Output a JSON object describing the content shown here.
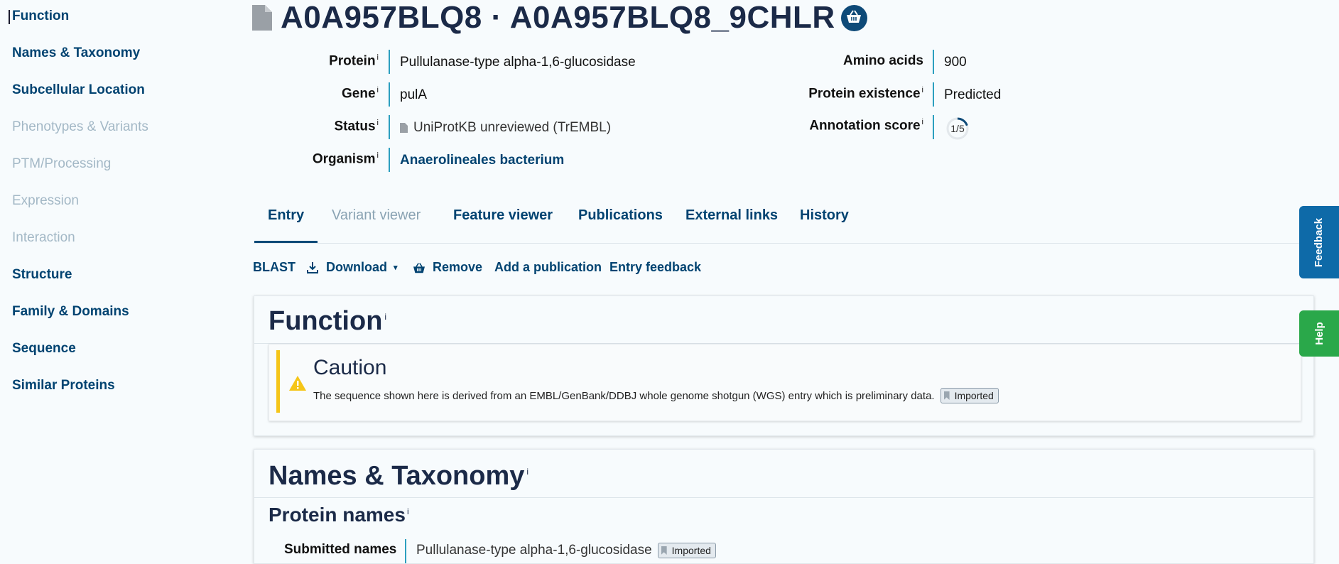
{
  "sidebar": {
    "items": [
      {
        "label": "Function",
        "state": "active"
      },
      {
        "label": "Names & Taxonomy",
        "state": "enabled"
      },
      {
        "label": "Subcellular Location",
        "state": "enabled"
      },
      {
        "label": "Phenotypes & Variants",
        "state": "disabled"
      },
      {
        "label": "PTM/Processing",
        "state": "disabled"
      },
      {
        "label": "Expression",
        "state": "disabled"
      },
      {
        "label": "Interaction",
        "state": "disabled"
      },
      {
        "label": "Structure",
        "state": "enabled"
      },
      {
        "label": "Family & Domains",
        "state": "enabled"
      },
      {
        "label": "Sequence",
        "state": "enabled"
      },
      {
        "label": "Similar Proteins",
        "state": "enabled"
      }
    ]
  },
  "header": {
    "title": "A0A957BLQ8 · A0A957BLQ8_9CHLR",
    "doc_icon": "document-icon",
    "basket_icon": "basket-icon"
  },
  "info": {
    "protein_label": "Protein",
    "protein_value": "Pullulanase-type alpha-1,6-glucosidase",
    "gene_label": "Gene",
    "gene_value": "pulA",
    "status_label": "Status",
    "status_value": "UniProtKB unreviewed (TrEMBL)",
    "organism_label": "Organism",
    "organism_value": "Anaerolineales bacterium",
    "amino_label": "Amino acids",
    "amino_value": "900",
    "existence_label": "Protein existence",
    "existence_value": "Predicted",
    "score_label": "Annotation score",
    "score_value": "1/5",
    "info_mark": "i"
  },
  "tabs": [
    {
      "label": "Entry",
      "state": "active"
    },
    {
      "label": "Variant viewer",
      "state": "disabled"
    },
    {
      "label": "Feature viewer",
      "state": "enabled"
    },
    {
      "label": "Publications",
      "state": "enabled"
    },
    {
      "label": "External links",
      "state": "enabled"
    },
    {
      "label": "History",
      "state": "enabled"
    }
  ],
  "actions": {
    "blast": "BLAST",
    "download": "Download",
    "remove": "Remove",
    "add_publication": "Add a publication",
    "entry_feedback": "Entry feedback"
  },
  "function_card": {
    "title": "Function",
    "caution_title": "Caution",
    "caution_text": "The sequence shown here is derived from an EMBL/GenBank/DDBJ whole genome shotgun (WGS) entry which is preliminary data.",
    "badge": "Imported"
  },
  "names_card": {
    "title": "Names & Taxonomy",
    "subtitle": "Protein names",
    "row_label": "Submitted names",
    "row_value": "Pullulanase-type alpha-1,6-glucosidase",
    "badge": "Imported"
  },
  "side_tabs": {
    "feedback": "Feedback",
    "help": "Help"
  },
  "colors": {
    "brand": "#014371",
    "accent_bar": "#2c9fbf",
    "caution": "#f5c518",
    "feedback_tab": "#0e6aa8",
    "help_tab": "#2aa84a"
  }
}
